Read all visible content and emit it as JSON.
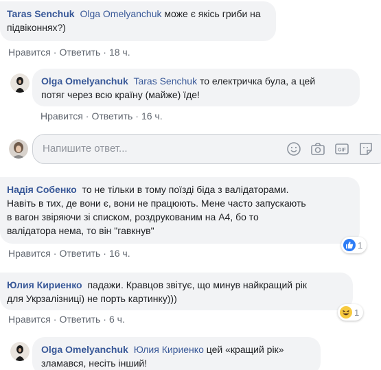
{
  "comments": [
    {
      "author": "Taras Senchuk",
      "mention": "Olga Omelyanchuk",
      "text_line1": "може є якісь гриби на",
      "text_line2": "підвіконнях?)",
      "like": "Нравится",
      "reply": "Ответить",
      "time": "18 ч."
    },
    {
      "author": "Olga Omelyanchuk",
      "mention": "Taras Senchuk",
      "text_line1": "то електричка була, а цей",
      "text_line2": "потяг через всю країну (майже) їде!",
      "like": "Нравится",
      "reply": "Ответить",
      "time": "16 ч."
    },
    {
      "author": "Надія Собенко",
      "text_line1": "то не тільки в тому поїзді біда з валідаторами.",
      "text_line2": "Навіть в тих, де вони є, вони не працюють. Мене часто запускають",
      "text_line3": "в вагон звіряючи зі списком, роздрукованим на А4, бо то",
      "text_line4": "валідатора нема, то він \"гавкнув\"",
      "like": "Нравится",
      "reply": "Ответить",
      "time": "16 ч.",
      "reaction_count": "1"
    },
    {
      "author": "Юлия Кириенко",
      "text_line1": "падажи. Кравцов звітує, що минув найкращий рік",
      "text_line2": "для Укрзалізниці) не порть картинку)))",
      "like": "Нравится",
      "reply": "Ответить",
      "time": "6 ч.",
      "reaction_count": "1"
    },
    {
      "author": "Olga Omelyanchuk",
      "mention": "Юлия Кириенко",
      "text_line1": "цей «кращий рік»",
      "text_line2": "зламався, несіть інший!"
    }
  ],
  "reply_box": {
    "placeholder": "Напишите ответ..."
  },
  "colors": {
    "link": "#385898",
    "bubble": "#f2f3f5",
    "meta": "#616770",
    "like_blue": "#2e7df6",
    "haha_yellow": "#f7c93e"
  }
}
